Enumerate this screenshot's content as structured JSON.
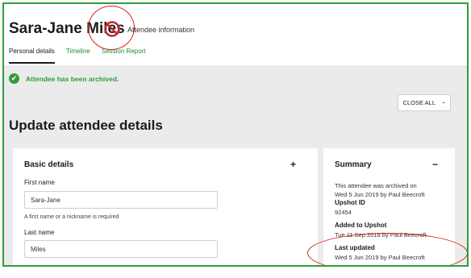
{
  "header": {
    "name": "Sara-Jane Miles",
    "subtitle": "Attendee information",
    "status_icon": "banned-icon"
  },
  "tabs": [
    {
      "label": "Personal details",
      "active": true
    },
    {
      "label": "Timeline",
      "active": false
    },
    {
      "label": "Session Report",
      "active": false
    }
  ],
  "alert": {
    "message": "Attendee has been archived.",
    "icon": "check-circle-icon",
    "check_glyph": "✔"
  },
  "toolbar": {
    "close_all_label": "CLOSE ALL",
    "close_all_symbol": "−"
  },
  "main": {
    "heading": "Update attendee details"
  },
  "basic_details": {
    "title": "Basic details",
    "toggle_symbol": "+",
    "first_name": {
      "label": "First name",
      "value": "Sara-Jane",
      "hint": "A first name or a nickname is required"
    },
    "last_name": {
      "label": "Last name",
      "value": "Miles"
    }
  },
  "summary": {
    "title": "Summary",
    "toggle_symbol": "−",
    "archived_line1": "This attendee was archived on",
    "archived_line2": "Wed 5 Jun 2019 by Paul Beecroft",
    "upshot_id_label": "Upshot ID",
    "upshot_id_value": "92454",
    "added_label": "Added to Upshot",
    "added_value": "Tue 11 Sep 2018 by Paul Beecroft",
    "updated_label": "Last updated",
    "updated_value": "Wed 5 Jun 2019 by Paul Beecroft"
  },
  "colors": {
    "accent_green": "#2e9e3c",
    "annotation_red": "#d8231f",
    "background_grey": "#ebebeb"
  }
}
